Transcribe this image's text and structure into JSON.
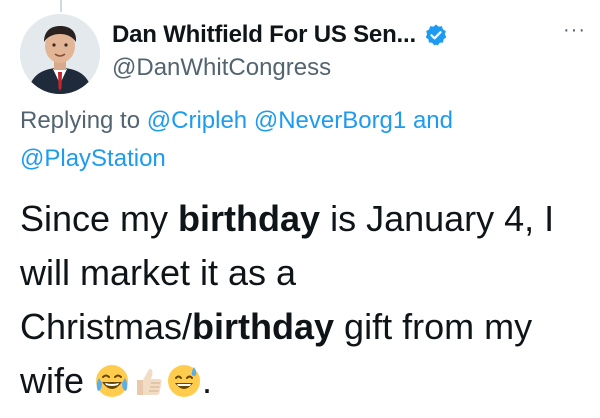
{
  "author": {
    "display_name": "Dan Whitfield For US Sen...",
    "handle": "@DanWhitCongress",
    "avatar_icon": "avatar",
    "verified_icon": "verified-badge-icon",
    "more_icon": "more-options-icon",
    "more_glyph": "···"
  },
  "reply": {
    "prefix": "Replying to",
    "mention_1": "@Cripleh",
    "mention_2": "@NeverBorg1",
    "conjunction": "and",
    "mention_3": "@PlayStation"
  },
  "tweet": {
    "part_1": "Since my ",
    "bold_1": "birthday",
    "part_2": " is January 4, I will market it as a Christmas/",
    "bold_2": "birthday",
    "part_3": " gift from my wife ",
    "emoji_1": "tears-of-joy-emoji",
    "emoji_2": "thumbs-up-emoji",
    "emoji_3": "grinning-sweat-emoji",
    "part_4": "."
  },
  "colors": {
    "text": "#0f1419",
    "secondary": "#536471",
    "link": "#1d9bf0",
    "verified": "#1d9bf0"
  }
}
